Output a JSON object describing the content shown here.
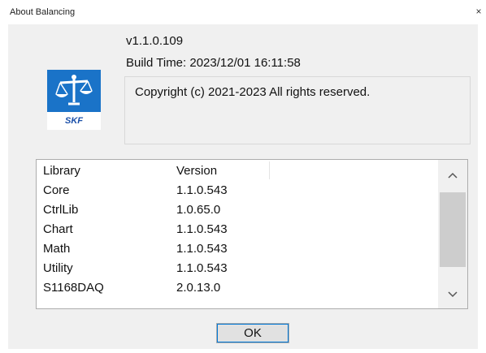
{
  "window": {
    "title": "About Balancing",
    "close_glyph": "×"
  },
  "logo": {
    "icon": "scale-balance-icon",
    "brand_text": "SKF",
    "brand_color": "#1a73c8"
  },
  "info": {
    "version": "v1.1.0.109",
    "build_time": "Build Time: 2023/12/01 16:11:58",
    "copyright": "Copyright (c) 2021-2023 All rights reserved."
  },
  "libraries": {
    "columns": [
      "Library",
      "Version"
    ],
    "rows": [
      {
        "name": "Core",
        "version": "1.1.0.543"
      },
      {
        "name": "CtrlLib",
        "version": "1.0.65.0"
      },
      {
        "name": "Chart",
        "version": "1.1.0.543"
      },
      {
        "name": "Math",
        "version": "1.1.0.543"
      },
      {
        "name": "Utility",
        "version": "1.1.0.543"
      },
      {
        "name": "S1168DAQ",
        "version": "2.0.13.0"
      }
    ]
  },
  "scrollbar": {
    "up_glyph": "^",
    "down_glyph": "v"
  },
  "buttons": {
    "ok_label": "OK"
  }
}
